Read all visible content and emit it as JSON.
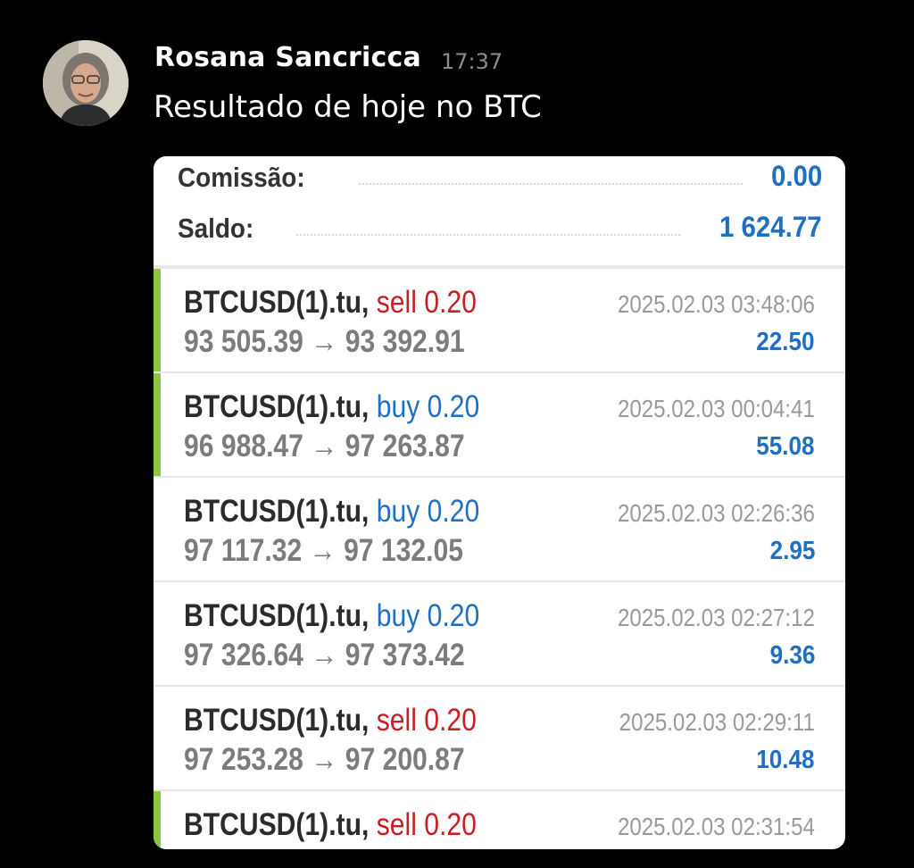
{
  "chat": {
    "sender": "Rosana Sancricca",
    "time": "17:37",
    "message": "Resultado de hoje no BTC",
    "avatar_icon": "user-avatar-photo"
  },
  "summary": {
    "commission_label": "Comissão:",
    "commission_value": "0.00",
    "balance_label": "Saldo:",
    "balance_value": "1 624.77"
  },
  "trades": [
    {
      "symbol": "BTCUSD(1).tu,",
      "side": "sell 0.20",
      "type": "sell",
      "prices": "93 505.39 → 93 392.91",
      "timestamp": "2025.02.03 03:48:06",
      "profit": "22.50",
      "accent": true
    },
    {
      "symbol": "BTCUSD(1).tu,",
      "side": "buy 0.20",
      "type": "buy",
      "prices": "96 988.47 → 97 263.87",
      "timestamp": "2025.02.03 00:04:41",
      "profit": "55.08",
      "accent": true
    },
    {
      "symbol": "BTCUSD(1).tu,",
      "side": "buy 0.20",
      "type": "buy",
      "prices": "97 117.32 → 97 132.05",
      "timestamp": "2025.02.03 02:26:36",
      "profit": "2.95",
      "accent": false
    },
    {
      "symbol": "BTCUSD(1).tu,",
      "side": "buy 0.20",
      "type": "buy",
      "prices": "97 326.64 → 97 373.42",
      "timestamp": "2025.02.03 02:27:12",
      "profit": "9.36",
      "accent": false
    },
    {
      "symbol": "BTCUSD(1).tu,",
      "side": "sell 0.20",
      "type": "sell",
      "prices": "97 253.28 → 97 200.87",
      "timestamp": "2025.02.03 02:29:11",
      "profit": "10.48",
      "accent": false
    },
    {
      "symbol": "BTCUSD(1).tu,",
      "side": "sell 0.20",
      "type": "sell",
      "prices": "",
      "timestamp": "2025.02.03 02:31:54",
      "profit": "",
      "accent": true
    }
  ],
  "colors": {
    "background": "#000000",
    "accent_green": "#8dc63f",
    "sell_red": "#c42126",
    "buy_blue": "#1f6fc2"
  }
}
